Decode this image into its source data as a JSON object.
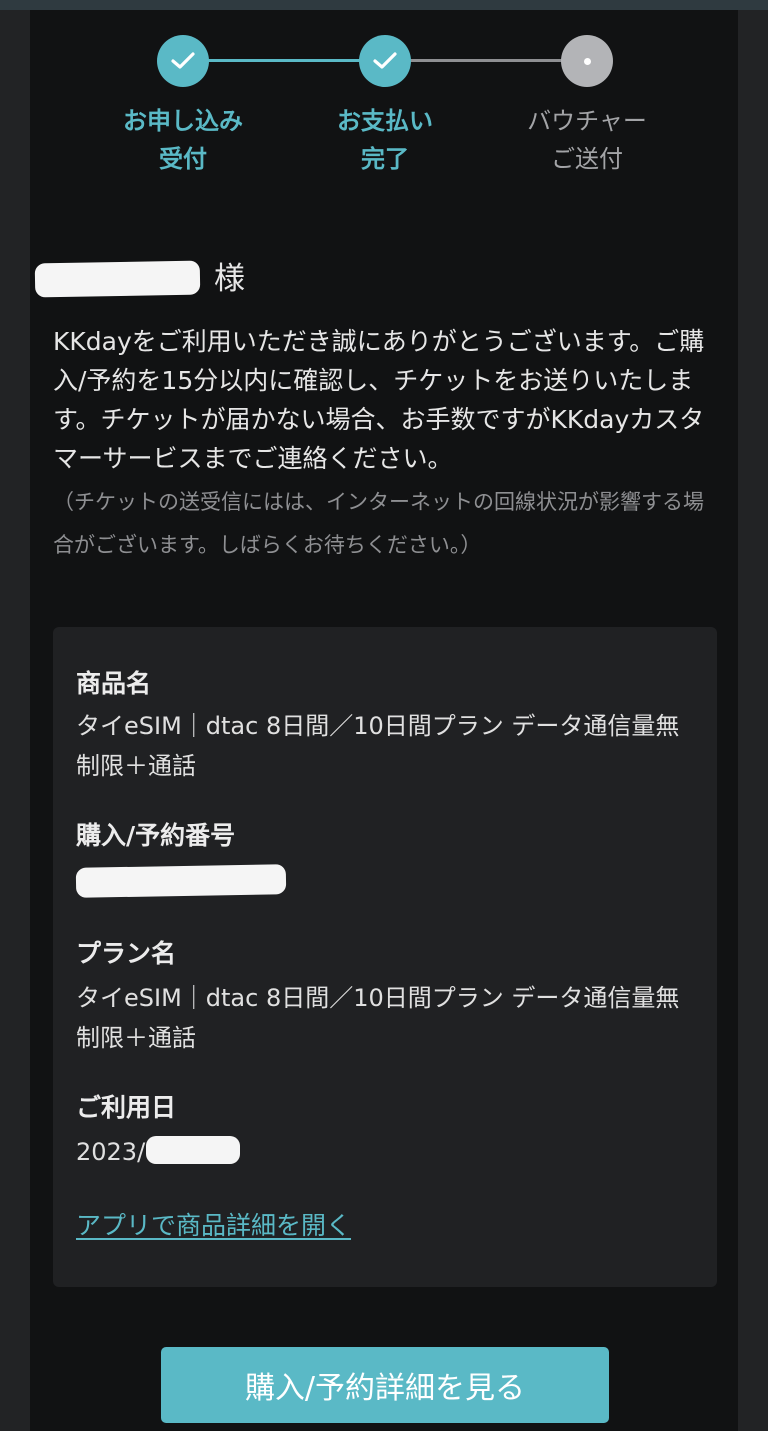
{
  "stepper": {
    "steps": [
      {
        "line1": "お申し込み",
        "line2": "受付",
        "state": "done"
      },
      {
        "line1": "お支払い",
        "line2": "完了",
        "state": "done"
      },
      {
        "line1": "バウチャー",
        "line2": "ご送付",
        "state": "pending"
      }
    ]
  },
  "greeting": {
    "honorific": "様",
    "intro": "KKdayをご利用いただき誠にありがとうございます。ご購入/予約を15分以内に確認し、チケットをお送りいたします。チケットが届かない場合、お手数ですがKKdayカスタマーサービスまでご連絡ください。",
    "note": "（チケットの送受信にはは、インターネットの回線状況が影響する場合がございます。しばらくお待ちください。）"
  },
  "order": {
    "product_label": "商品名",
    "product_value": "タイeSIM｜dtac 8日間／10日間プラン データ通信量無制限＋通話",
    "number_label": "購入/予約番号",
    "plan_label": "プラン名",
    "plan_value": "タイeSIM｜dtac 8日間／10日間プラン データ通信量無制限＋通話",
    "date_label": "ご利用日",
    "date_value": "2023/",
    "app_link": "アプリで商品詳細を開く"
  },
  "actions": {
    "detail_button": "購入/予約詳細を見る"
  },
  "colors": {
    "accent": "#5ab9c6",
    "background": "#111213",
    "card": "#202123"
  },
  "icons": [
    "check-icon",
    "dot-icon"
  ]
}
